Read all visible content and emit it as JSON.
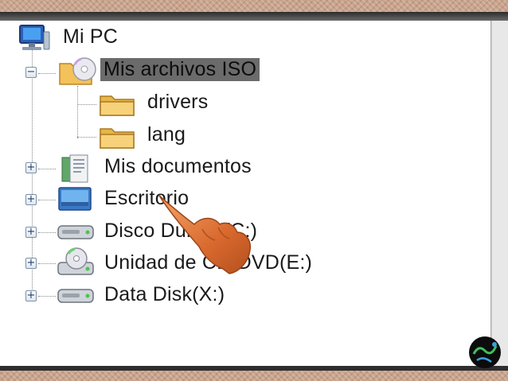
{
  "tree": {
    "root": {
      "label": "Mi PC",
      "icon": "computer-icon"
    },
    "items": [
      {
        "label": "Mis archivos ISO",
        "icon": "iso-folder-icon",
        "toggle": "−",
        "selected": true,
        "children": [
          {
            "label": "drivers",
            "icon": "folder-icon"
          },
          {
            "label": "lang",
            "icon": "folder-icon"
          }
        ]
      },
      {
        "label": "Mis documentos",
        "icon": "documents-icon",
        "toggle": "+"
      },
      {
        "label": "Escritorio",
        "icon": "desktop-icon",
        "toggle": "+"
      },
      {
        "label": "Disco Duro X(C:)",
        "icon": "hard-drive-icon",
        "toggle": "+"
      },
      {
        "label": "Unidad de CD/DVD(E:)",
        "icon": "cd-drive-icon",
        "toggle": "+"
      },
      {
        "label": "Data Disk(X:)",
        "icon": "hard-drive-icon",
        "toggle": "+"
      }
    ]
  },
  "colors": {
    "selection": "#6b6b6b",
    "hand": "#e07a3a"
  }
}
